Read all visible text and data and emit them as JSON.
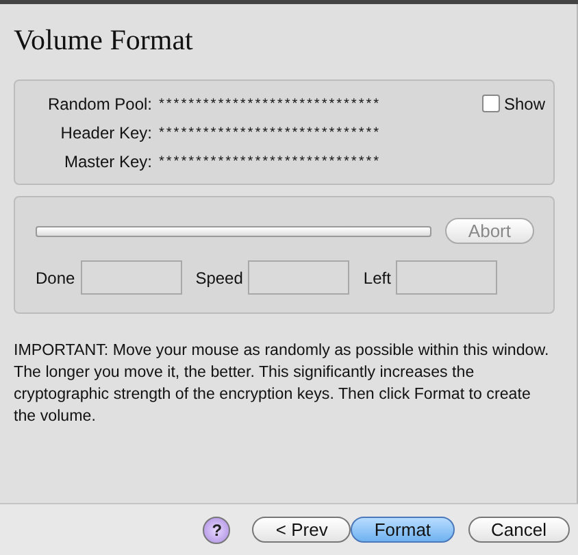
{
  "title": "Volume Format",
  "keys": [
    {
      "label": "Random Pool:",
      "value": "******************************"
    },
    {
      "label": "Header Key:",
      "value": "******************************"
    },
    {
      "label": "Master Key:",
      "value": "******************************"
    }
  ],
  "show": {
    "label": "Show",
    "checked": false
  },
  "progress": {
    "level": 0
  },
  "abort": {
    "label": "Abort",
    "disabled": true
  },
  "stats": [
    {
      "label": "Done"
    },
    {
      "label": "Speed"
    },
    {
      "label": "Left"
    }
  ],
  "notice": "IMPORTANT: Move your mouse as randomly as possible within this window. The longer you move it, the better. This significantly increases the cryptographic strength of the encryption keys. Then click Format to create the volume.",
  "help": "?",
  "buttons": [
    {
      "label": "< Prev",
      "default": false
    },
    {
      "label": "Format",
      "default": true
    },
    {
      "label": "Cancel",
      "default": false
    }
  ]
}
